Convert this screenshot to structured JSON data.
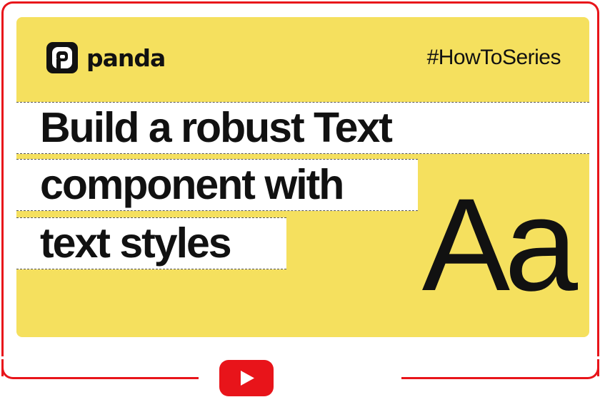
{
  "thumbnail": {
    "brand": {
      "name": "panda",
      "icon": "panda-logo-icon"
    },
    "hashtag": "#HowToSeries",
    "headline": {
      "line1": "Build a robust Text",
      "line2": "component with",
      "line3": "text styles"
    },
    "glyph_sample": "Aa",
    "background_color": "#f5e05e"
  },
  "player": {
    "play_icon": "youtube-play-icon",
    "accent_color": "#e8141a"
  }
}
